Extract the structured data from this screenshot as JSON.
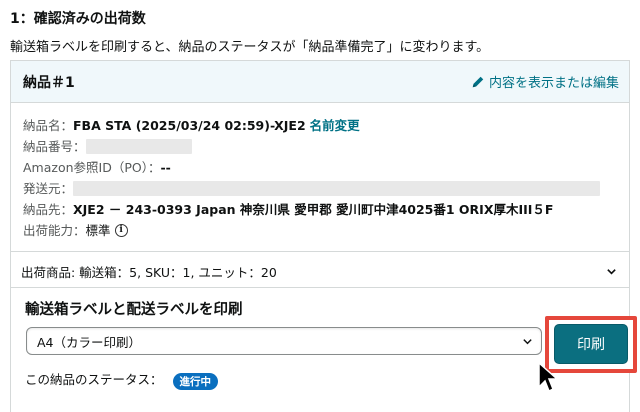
{
  "step": {
    "title": "1：確認済みの出荷数",
    "description": "輸送箱ラベルを印刷すると、納品のステータスが「納品準備完了」に変わります。"
  },
  "shipment": {
    "title": "納品＃1",
    "edit_link": "内容を表示または編集",
    "name_label": "納品名：",
    "name_value": "FBA STA (2025/03/24 02:59)-XJE2",
    "rename": "名前変更",
    "number_label": "納品番号：",
    "ref_label": "Amazon参照ID（PO）：",
    "ref_value": "--",
    "from_label": "発送元：",
    "to_label": "納品先：",
    "to_value": "XJE2 － 243-0393 Japan 神奈川県 愛甲郡 愛川町中津4025番1 ORIX厚木III５F",
    "capacity_label": "出荷能力：",
    "capacity_value": "標準",
    "items_summary": "出荷商品: 輸送箱：5, SKU：1, ユニット：20"
  },
  "print": {
    "title": "輸送箱ラベルと配送ラベルを印刷",
    "paper_selected": "A4（カラー印刷）",
    "button": "印刷",
    "status_label": "この納品のステータス：",
    "status_value": "進行中"
  },
  "colors": {
    "link": "#007185",
    "print_button": "#0b6f80",
    "highlight_border": "#e5473b",
    "status_badge": "#0a6fbf",
    "header_bg": "#f0f8fb"
  },
  "icons": {
    "edit": "pencil-icon",
    "info": "info-icon",
    "expand": "chevron-down-icon",
    "select": "chevron-down-icon",
    "pointer": "mouse-cursor-icon"
  }
}
